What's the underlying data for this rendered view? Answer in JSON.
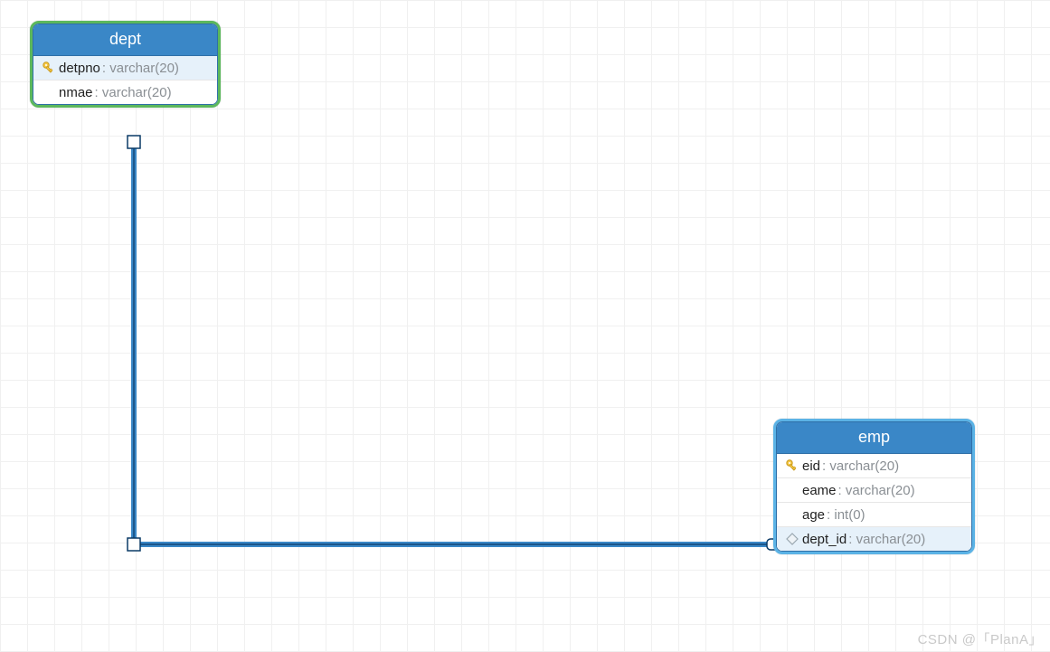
{
  "entities": {
    "dept": {
      "title": "dept",
      "columns": [
        {
          "name": "detpno",
          "type": "varchar(20)",
          "key": true,
          "fk": false,
          "highlight": true
        },
        {
          "name": "nmae",
          "type": "varchar(20)",
          "key": false,
          "fk": false,
          "highlight": false
        }
      ]
    },
    "emp": {
      "title": "emp",
      "columns": [
        {
          "name": "eid",
          "type": "varchar(20)",
          "key": true,
          "fk": false,
          "highlight": false
        },
        {
          "name": "eame",
          "type": "varchar(20)",
          "key": false,
          "fk": false,
          "highlight": false
        },
        {
          "name": "age",
          "type": "int(0)",
          "key": false,
          "fk": false,
          "highlight": false
        },
        {
          "name": "dept_id",
          "type": "varchar(20)",
          "key": false,
          "fk": true,
          "highlight": true
        }
      ]
    }
  },
  "relation": {
    "from_entity": "dept",
    "from_column": "detpno",
    "to_entity": "emp",
    "to_column": "dept_id"
  },
  "watermark": "CSDN @「PlanA」"
}
